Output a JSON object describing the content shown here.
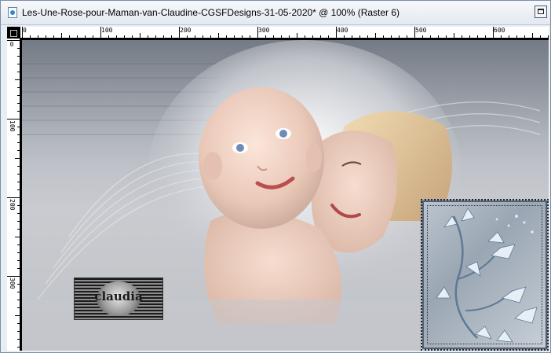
{
  "window": {
    "title": "Les-Une-Rose-pour-Maman-van-Claudine-CGSFDesigns-31-05-2020* @ 100% (Raster 6)"
  },
  "ruler": {
    "h_labels": [
      "0",
      "100",
      "200",
      "300",
      "400",
      "500",
      "600"
    ],
    "v_labels": [
      "0",
      "100",
      "200",
      "300"
    ]
  },
  "canvas": {
    "watermark_text": "claudia"
  },
  "colors": {
    "titlebar": "#e3e9f0",
    "canvas_bg": "#bfc2c6",
    "accent_blue": "#2d8ad8"
  }
}
